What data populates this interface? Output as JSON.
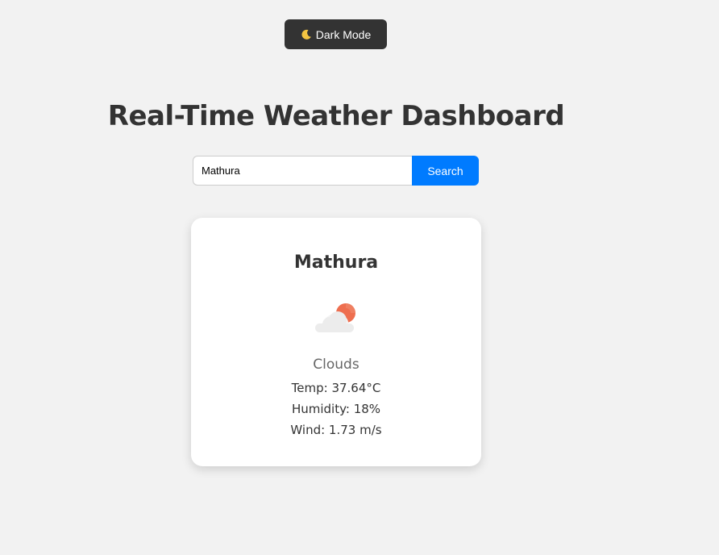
{
  "toggle": {
    "icon": "moon-icon",
    "label": "Dark Mode"
  },
  "header": {
    "title": "Real-Time Weather Dashboard"
  },
  "search": {
    "value": "Mathura",
    "button_label": "Search"
  },
  "weather": {
    "city": "Mathura",
    "icon": "cloud-sun-icon",
    "description": "Clouds",
    "temp": "Temp: 37.64°C",
    "humidity": "Humidity: 18%",
    "wind": "Wind: 1.73 m/s"
  },
  "colors": {
    "background": "#f2f2f2",
    "dark_button": "#333333",
    "accent": "#007bff",
    "sun": "#ee6e4f",
    "cloud": "#eeeeee"
  }
}
